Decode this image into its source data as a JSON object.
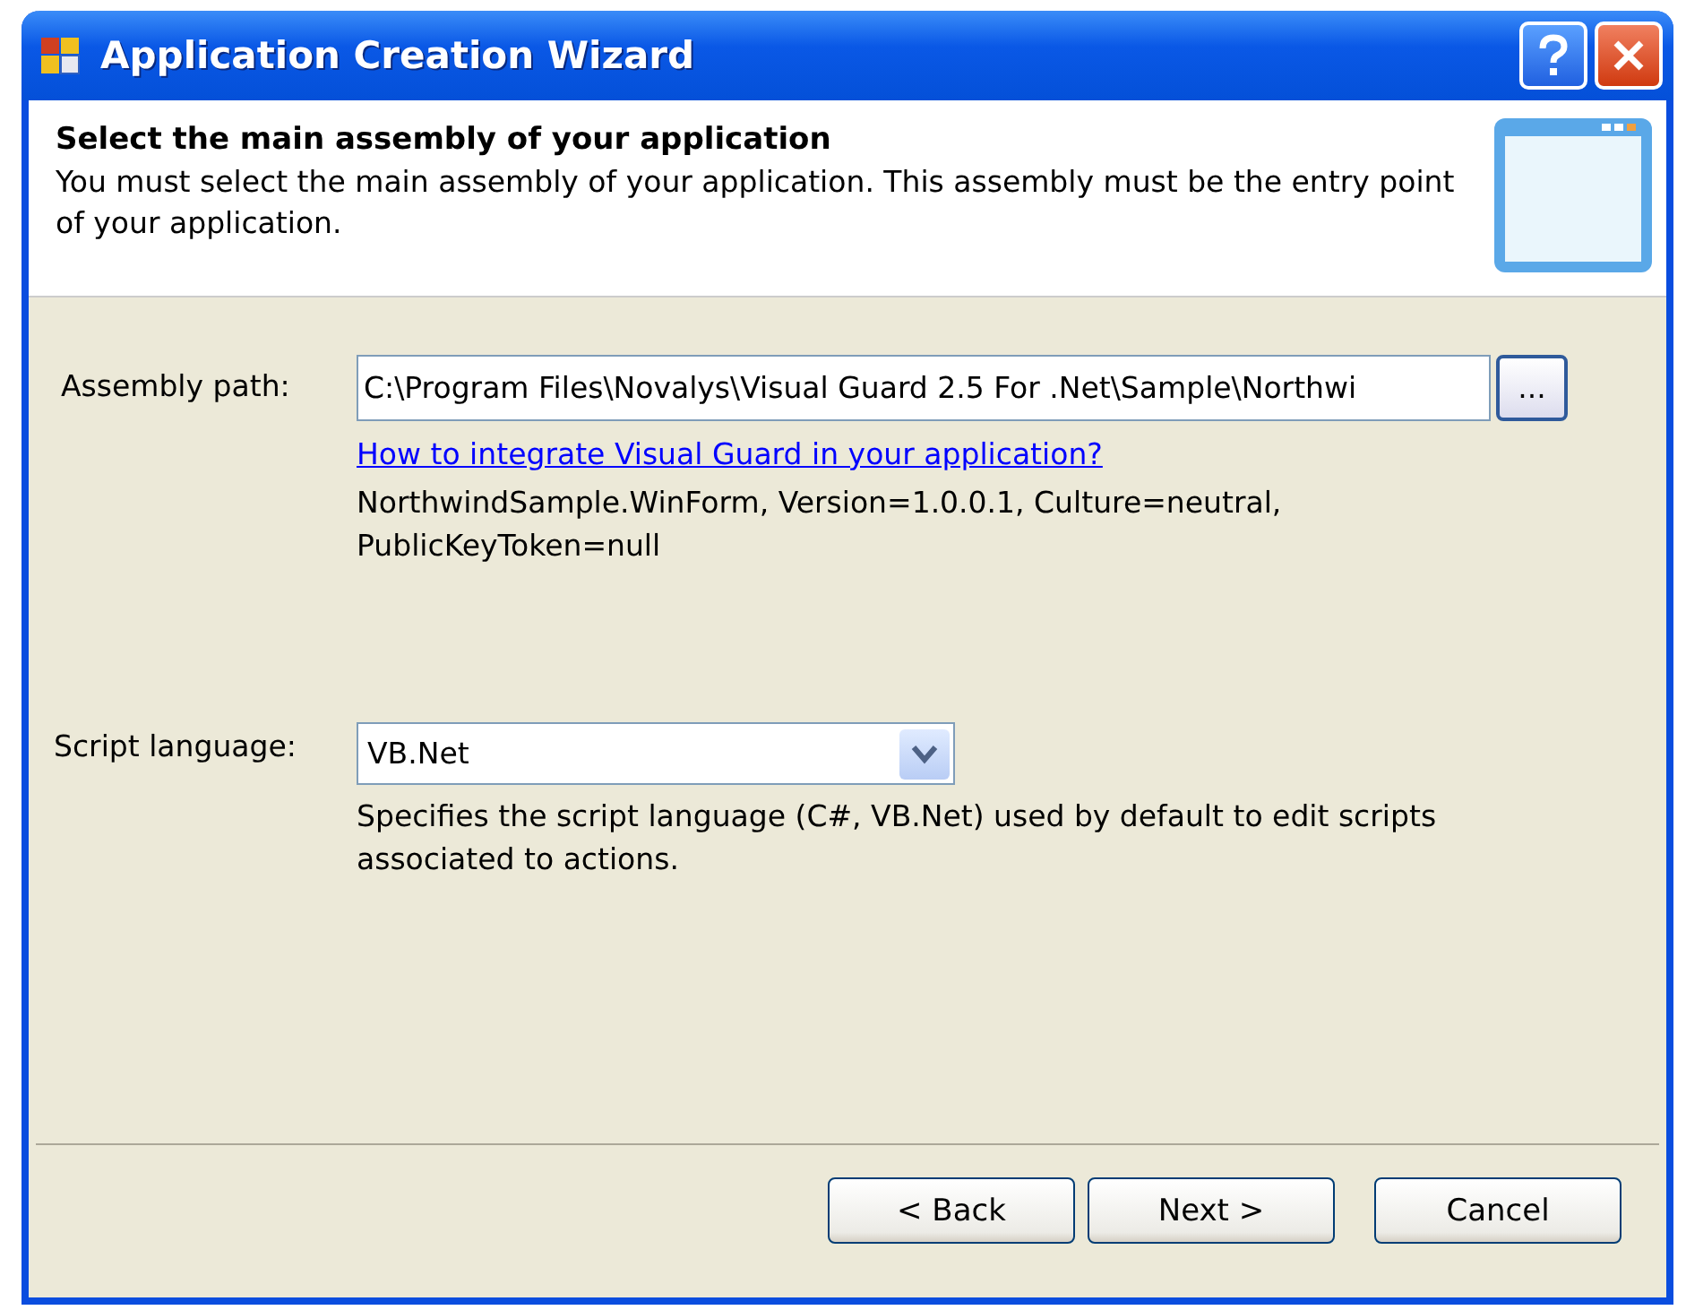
{
  "window": {
    "title": "Application Creation Wizard"
  },
  "header": {
    "title": "Select the main assembly of your application",
    "description": "You must select the main assembly of your application. This assembly must be the entry point of your application."
  },
  "assembly": {
    "label": "Assembly path:",
    "value": "C:\\Program Files\\Novalys\\Visual Guard 2.5 For .Net\\Sample\\Northwi",
    "browse": "...",
    "link": "How to integrate Visual Guard in your application?",
    "info": "NorthwindSample.WinForm, Version=1.0.0.1, Culture=neutral, PublicKeyToken=null"
  },
  "script": {
    "label": "Script language:",
    "value": "VB.Net",
    "hint": "Specifies the script language (C#, VB.Net) used by default to edit scripts associated to actions."
  },
  "buttons": [
    "< Back",
    "Next >",
    "Cancel"
  ]
}
